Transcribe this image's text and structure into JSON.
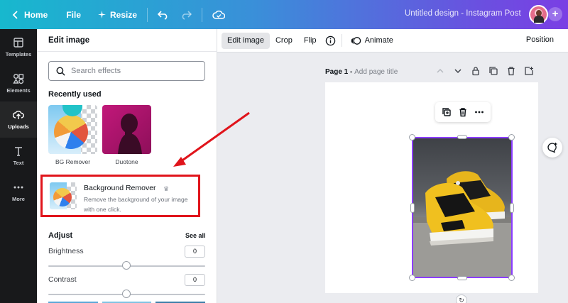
{
  "topbar": {
    "home": "Home",
    "file": "File",
    "resize": "Resize",
    "design_title": "Untitled design - Instagram Post",
    "plus": "+"
  },
  "rail": {
    "items": [
      {
        "label": "Templates",
        "icon": "templates-icon"
      },
      {
        "label": "Elements",
        "icon": "elements-icon"
      },
      {
        "label": "Uploads",
        "icon": "uploads-icon"
      },
      {
        "label": "Text",
        "icon": "text-icon"
      },
      {
        "label": "More",
        "icon": "more-icon"
      }
    ],
    "active": "Uploads"
  },
  "panel": {
    "title": "Edit image",
    "search_placeholder": "Search effects",
    "recently_used_title": "Recently used",
    "recent": [
      {
        "label": "BG Remover"
      },
      {
        "label": "Duotone"
      }
    ],
    "background_remover": {
      "title": "Background Remover",
      "description": "Remove the background of your image with one click."
    },
    "adjust": {
      "title": "Adjust",
      "see_all": "See all",
      "brightness_label": "Brightness",
      "brightness_value": "0",
      "contrast_label": "Contrast",
      "contrast_value": "0"
    }
  },
  "toolbar": {
    "edit_image": "Edit image",
    "crop": "Crop",
    "flip": "Flip",
    "animate": "Animate",
    "position": "Position"
  },
  "page": {
    "label_prefix": "Page 1 - ",
    "label_placeholder": "Add page title"
  },
  "colors": {
    "accent": "#8b3dff",
    "annotation": "#e0141b",
    "rail_bg": "#18191b",
    "gradient_start": "#17b8ce",
    "gradient_end": "#7a3fe4"
  }
}
